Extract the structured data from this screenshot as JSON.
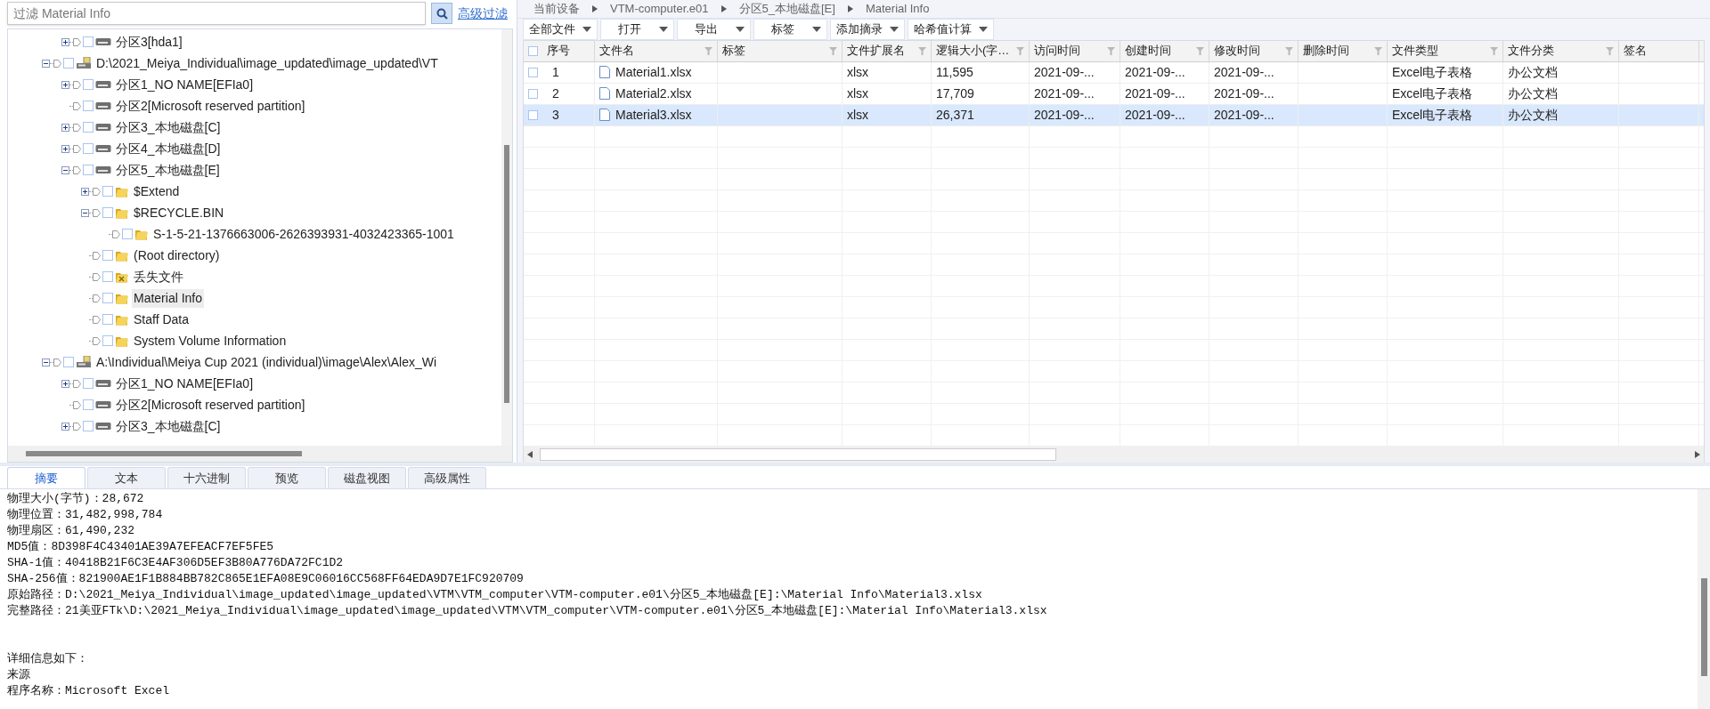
{
  "filter": {
    "placeholder": "过滤 Material Info",
    "advanced_link": "高级过滤"
  },
  "tree": {
    "partial_children": [
      {
        "kind": "partition",
        "label": "分区3[hda1]",
        "expanded": false,
        "selected": false,
        "checked": false
      }
    ],
    "items": [
      {
        "kind": "device",
        "label": "D:\\2021_Meiya_Individual\\image_updated\\image_updated\\VT",
        "expanded": true,
        "selected": false,
        "checked": false,
        "children": [
          {
            "kind": "partition",
            "label": "分区1_NO NAME[EFIa0]",
            "expanded": false,
            "selected": false,
            "checked": false
          },
          {
            "kind": "partition",
            "label": "分区2[Microsoft reserved partition]",
            "selected": false,
            "checked": false
          },
          {
            "kind": "partition",
            "label": "分区3_本地磁盘[C]",
            "expanded": false,
            "selected": false,
            "checked": false
          },
          {
            "kind": "partition",
            "label": "分区4_本地磁盘[D]",
            "expanded": false,
            "selected": false,
            "checked": false
          },
          {
            "kind": "partition",
            "label": "分区5_本地磁盘[E]",
            "expanded": true,
            "selected": false,
            "checked": false,
            "children": [
              {
                "kind": "folder",
                "label": "$Extend",
                "expanded": false,
                "selected": false,
                "checked": false
              },
              {
                "kind": "folder",
                "label": "$RECYCLE.BIN",
                "expanded": true,
                "selected": false,
                "checked": false,
                "children": [
                  {
                    "kind": "folder",
                    "label": "S-1-5-21-1376663006-2626393931-4032423365-1001",
                    "selected": false,
                    "checked": false
                  }
                ]
              },
              {
                "kind": "folder",
                "label": "(Root directory)",
                "selected": false,
                "checked": false
              },
              {
                "kind": "lost",
                "label": "丢失文件",
                "selected": false,
                "checked": false
              },
              {
                "kind": "folder",
                "label": "Material Info",
                "selected": true,
                "checked": false
              },
              {
                "kind": "folder",
                "label": "Staff Data",
                "selected": false,
                "checked": false
              },
              {
                "kind": "folder",
                "label": "System Volume Information",
                "selected": false,
                "checked": false
              }
            ]
          }
        ]
      },
      {
        "kind": "device",
        "label": "A:\\Individual\\Meiya Cup 2021 (individual)\\image\\Alex\\Alex_Wi",
        "expanded": true,
        "selected": false,
        "checked": false,
        "children": [
          {
            "kind": "partition",
            "label": "分区1_NO NAME[EFIa0]",
            "expanded": false,
            "selected": false,
            "checked": false
          },
          {
            "kind": "partition",
            "label": "分区2[Microsoft reserved partition]",
            "selected": false,
            "checked": false
          },
          {
            "kind": "partition",
            "label": "分区3_本地磁盘[C]",
            "expanded": false,
            "selected": false,
            "checked": false
          }
        ]
      }
    ]
  },
  "breadcrumb": [
    "当前设备",
    "VTM-computer.e01",
    "分区5_本地磁盘[E]",
    "Material Info"
  ],
  "toolbar": [
    "全部文件",
    "打开",
    "导出",
    "标签",
    "添加摘录",
    "哈希值计算"
  ],
  "table": {
    "all_checked": false,
    "columns": [
      {
        "label": "序号",
        "filter": false
      },
      {
        "label": "文件名",
        "filter": true
      },
      {
        "label": "标签",
        "filter": true
      },
      {
        "label": "文件扩展名",
        "filter": true
      },
      {
        "label": "逻辑大小(字…",
        "filter": true
      },
      {
        "label": "访问时间",
        "filter": true
      },
      {
        "label": "创建时间",
        "filter": true
      },
      {
        "label": "修改时间",
        "filter": true
      },
      {
        "label": "删除时间",
        "filter": true
      },
      {
        "label": "文件类型",
        "filter": true
      },
      {
        "label": "文件分类",
        "filter": true
      },
      {
        "label": "签名",
        "filter": false
      }
    ],
    "rows": [
      {
        "selected": false,
        "checked": false,
        "cells": [
          "1",
          "Material1.xlsx",
          "",
          "xlsx",
          "11,595",
          "2021-09-...",
          "2021-09-...",
          "2021-09-...",
          "",
          "Excel电子表格",
          "办公文档",
          ""
        ]
      },
      {
        "selected": false,
        "checked": false,
        "cells": [
          "2",
          "Material2.xlsx",
          "",
          "xlsx",
          "17,709",
          "2021-09-...",
          "2021-09-...",
          "2021-09-...",
          "",
          "Excel电子表格",
          "办公文档",
          ""
        ]
      },
      {
        "selected": true,
        "checked": false,
        "cells": [
          "3",
          "Material3.xlsx",
          "",
          "xlsx",
          "26,371",
          "2021-09-...",
          "2021-09-...",
          "2021-09-...",
          "",
          "Excel电子表格",
          "办公文档",
          ""
        ]
      }
    ]
  },
  "tabs": [
    {
      "label": "摘要",
      "selected": true
    },
    {
      "label": "文本",
      "selected": false
    },
    {
      "label": "十六进制",
      "selected": false
    },
    {
      "label": "预览",
      "selected": false
    },
    {
      "label": "磁盘视图",
      "selected": false
    },
    {
      "label": "高级属性",
      "selected": false
    }
  ],
  "summary": [
    [
      "物理大小(字节)：28,672",
      "物理位置：31,482,998,784",
      "物理扇区：61,490,232",
      "MD5值：8D398F4C43401AE39A7EFEACF7EF5FE5",
      "SHA-1值：40418B21F6C3E4AF306D5EF3B80A776DA72FC1D2",
      "SHA-256值：821900AE1F1B884BB782C865E1EFA08E9C06016CC568FF64EDA9D7E1FC920709",
      "原始路径：D:\\2021_Meiya_Individual\\image_updated\\image_updated\\VTM\\VTM_computer\\VTM-computer.e01\\分区5_本地磁盘[E]:\\Material Info\\Material3.xlsx",
      "完整路径：21美亚FTk\\D:\\2021_Meiya_Individual\\image_updated\\image_updated\\VTM\\VTM_computer\\VTM-computer.e01\\分区5_本地磁盘[E]:\\Material Info\\Material3.xlsx"
    ],
    [
      "详细信息如下：",
      "来源",
      "程序名称：Microsoft Excel"
    ]
  ]
}
